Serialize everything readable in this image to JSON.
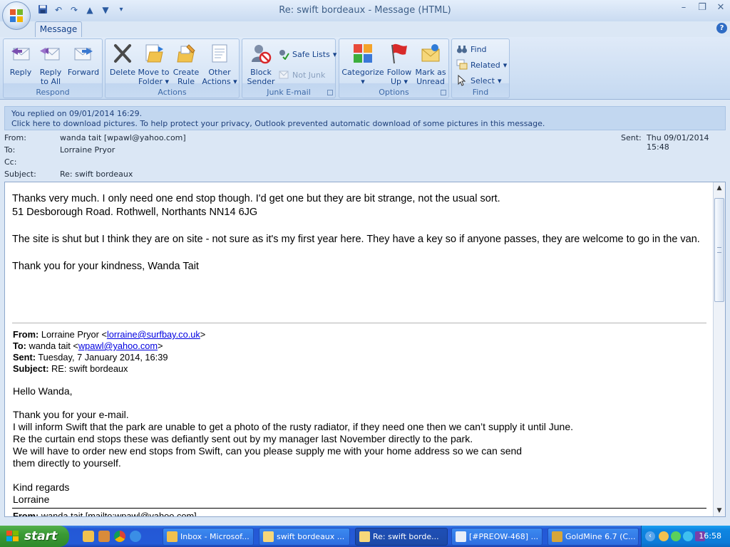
{
  "window": {
    "title": "Re: swift bordeaux  -  Message (HTML)",
    "controls": [
      "minimize",
      "restore",
      "close"
    ]
  },
  "ribbon": {
    "tabs": [
      {
        "label": "Message"
      }
    ],
    "groups": {
      "respond": {
        "label": "Respond",
        "reply": "Reply",
        "reply_all_1": "Reply",
        "reply_all_2": "to All",
        "forward": "Forward"
      },
      "actions": {
        "label": "Actions",
        "delete": "Delete",
        "move_1": "Move to",
        "move_2": "Folder",
        "create_1": "Create",
        "create_2": "Rule",
        "other_1": "Other",
        "other_2": "Actions"
      },
      "junk": {
        "label": "Junk E-mail",
        "block_1": "Block",
        "block_2": "Sender",
        "safe_lists": "Safe Lists",
        "not_junk": "Not Junk"
      },
      "options": {
        "label": "Options",
        "categorize": "Categorize",
        "follow_1": "Follow",
        "follow_2": "Up",
        "mark_1": "Mark as",
        "mark_2": "Unread"
      },
      "find": {
        "label": "Find",
        "find": "Find",
        "related": "Related",
        "select": "Select"
      }
    }
  },
  "infobar": {
    "line1": "You replied on 09/01/2014 16:29.",
    "line2": "Click here to download pictures. To help protect your privacy, Outlook prevented automatic download of some pictures in this message."
  },
  "header": {
    "from_label": "From:",
    "from_value": "wanda tait [wpawl@yahoo.com]",
    "to_label": "To:",
    "to_value": "Lorraine Pryor",
    "cc_label": "Cc:",
    "subject_label": "Subject:",
    "subject_value": "Re: swift bordeaux",
    "sent_label": "Sent:",
    "sent_value": "Thu 09/01/2014 15:48"
  },
  "body": {
    "line1": "Thanks very much. I only need one end stop though. I'd get one but they are bit strange, not the usual sort.",
    "line2": "51 Desborough Road. Rothwell, Northants NN14 6JG",
    "line3": "The site is shut but I think they are on site - not sure as it's my first year here. They have a key so if anyone passes, they are welcome to go in the van.",
    "line4": "Thank you for your kindness, Wanda Tait"
  },
  "quoted": {
    "from_label": "From:",
    "from_name": "Lorraine Pryor <",
    "from_email": "lorraine@surfbay.co.uk",
    "from_close": ">",
    "to_label": "To:",
    "to_name": "wanda tait <",
    "to_email": "wpawl@yahoo.com",
    "to_close": ">",
    "sent_label": "Sent:",
    "sent_value": "Tuesday, 7 January 2014, 16:39",
    "subject_label": "Subject:",
    "subject_value": "RE: swift bordeaux",
    "greeting": "Hello Wanda,",
    "p1": "Thank you for your e-mail.",
    "p2": "I will inform Swift that the park are unable to get a photo of the rusty radiator, if they need one then we can’t supply it until June.",
    "p3": "Re the curtain end stops these was defiantly sent out by my manager last November directly to the park.",
    "p4": "We will have to order new end stops from Swift, can you please supply me with your home address so we can send",
    "p5": "them directly to yourself.",
    "regards": "Kind regards",
    "signature": "Lorraine",
    "next_from_label": "From:",
    "next_from_value": "wanda tait [mailto:wpawl@yahoo.com]"
  },
  "taskbar": {
    "start": "start",
    "tasks": [
      {
        "label": "Inbox - Microsof..."
      },
      {
        "label": "swift bordeaux ..."
      },
      {
        "label": "Re: swift borde..."
      },
      {
        "label": "[#PREOW-468] ..."
      },
      {
        "label": "GoldMine 6.7 (C..."
      }
    ],
    "clock": "16:58"
  }
}
